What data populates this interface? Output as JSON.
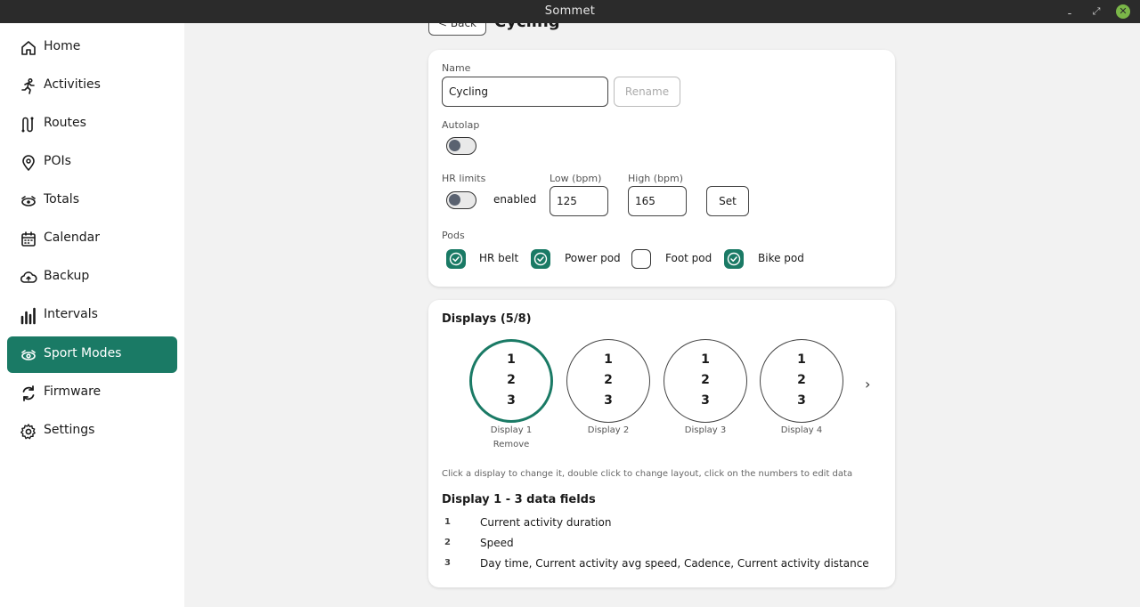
{
  "window": {
    "title": "Sommet",
    "minimize": "ـ",
    "maximize": "⤢",
    "close": "✕"
  },
  "sidebar": {
    "items": [
      {
        "label": "Home",
        "icon": "home-icon"
      },
      {
        "label": "Activities",
        "icon": "running-icon"
      },
      {
        "label": "Routes",
        "icon": "routes-icon"
      },
      {
        "label": "POIs",
        "icon": "pin-icon"
      },
      {
        "label": "Totals",
        "icon": "totals-icon"
      },
      {
        "label": "Calendar",
        "icon": "calendar-icon"
      },
      {
        "label": "Backup",
        "icon": "cloud-icon"
      },
      {
        "label": "Intervals",
        "icon": "bars-icon"
      },
      {
        "label": "Sport Modes",
        "icon": "sport-icon",
        "active": true
      },
      {
        "label": "Firmware",
        "icon": "refresh-icon"
      },
      {
        "label": "Settings",
        "icon": "gear-icon"
      }
    ]
  },
  "header": {
    "back_label": "< Back",
    "title": "Cycling"
  },
  "settings": {
    "name_label": "Name",
    "name_value": "Cycling",
    "rename_label": "Rename",
    "autolap_label": "Autolap",
    "hr_limits_label": "HR limits",
    "hr_enabled_label": "enabled",
    "low_label": "Low (bpm)",
    "low_value": "125",
    "high_label": "High (bpm)",
    "high_value": "165",
    "set_label": "Set",
    "pods_label": "Pods",
    "pods": [
      {
        "label": "HR belt",
        "checked": true
      },
      {
        "label": "Power pod",
        "checked": true
      },
      {
        "label": "Foot pod",
        "checked": false
      },
      {
        "label": "Bike pod",
        "checked": true
      }
    ]
  },
  "displays": {
    "title": "Displays (5/8)",
    "items": [
      {
        "label": "Display 1",
        "rows": [
          "1",
          "2",
          "3"
        ],
        "selected": true,
        "remove_label": "Remove"
      },
      {
        "label": "Display 2",
        "rows": [
          "1",
          "2",
          "3"
        ]
      },
      {
        "label": "Display 3",
        "rows": [
          "1",
          "2",
          "3"
        ]
      },
      {
        "label": "Display 4",
        "rows": [
          "1",
          "2",
          "3"
        ]
      }
    ],
    "next_label": "›",
    "hint": "Click a display to change it, double click to change layout, click on the numbers to edit data",
    "fields_title": "Display 1 - 3 data fields",
    "fields": [
      {
        "num": "1",
        "text": "Current activity duration"
      },
      {
        "num": "2",
        "text": "Speed"
      },
      {
        "num": "3",
        "text": "Day time, Current activity avg speed, Cadence, Current activity distance"
      }
    ]
  },
  "colors": {
    "accent": "#1a7a65",
    "titlebar": "#2b2b2b",
    "background": "#f2f2f2"
  }
}
